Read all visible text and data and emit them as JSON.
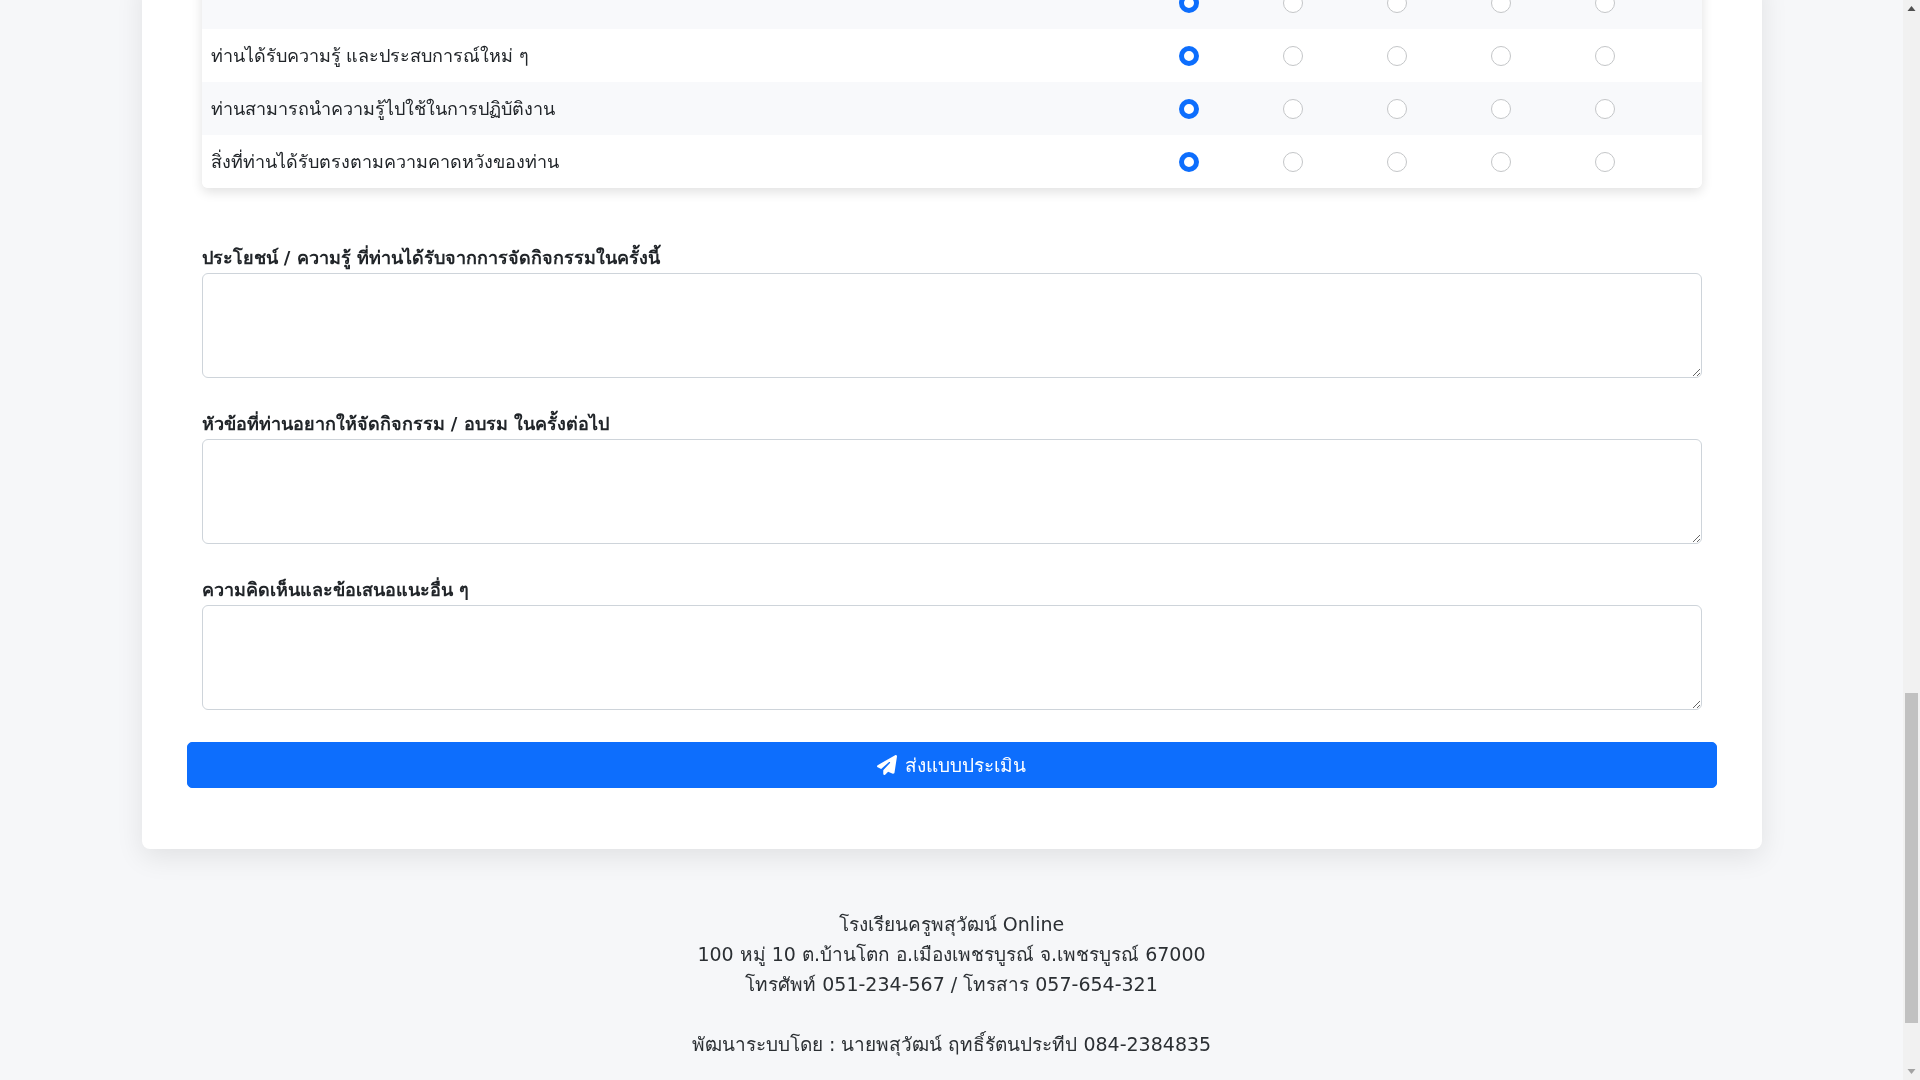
{
  "rating_table": {
    "rows": [
      {
        "ratings": [
          {
            "selected": true
          },
          {
            "selected": false
          },
          {
            "selected": false
          },
          {
            "selected": false
          },
          {
            "selected": false
          }
        ]
      },
      {
        "statement": "ท่านได้รับความรู้ และประสบการณ์ใหม่ ๆ",
        "ratings": [
          {
            "selected": true
          },
          {
            "selected": false
          },
          {
            "selected": false
          },
          {
            "selected": false
          },
          {
            "selected": false
          }
        ]
      },
      {
        "statement": "ท่านสามารถนำความรู้ไปใช้ในการปฏิบัติงาน",
        "ratings": [
          {
            "selected": true
          },
          {
            "selected": false
          },
          {
            "selected": false
          },
          {
            "selected": false
          },
          {
            "selected": false
          }
        ]
      },
      {
        "statement": "สิ่งที่ท่านได้รับตรงตามความคาดหวังของท่าน",
        "ratings": [
          {
            "selected": true
          },
          {
            "selected": false
          },
          {
            "selected": false
          },
          {
            "selected": false
          },
          {
            "selected": false
          }
        ]
      }
    ]
  },
  "questions": [
    {
      "label": "ประโยชน์ / ความรู้ ที่ท่านได้รับจากการจัดกิจกรรมในครั้งนี้"
    },
    {
      "label": "หัวข้อที่ท่านอยากให้จัดกิจกรรม / อบรม ในครั้งต่อไป"
    },
    {
      "label": "ความคิดเห็นและข้อเสนอแนะอื่น ๆ"
    }
  ],
  "submit_button": {
    "label": "ส่งแบบประเมิน"
  },
  "footer": {
    "lines": [
      "โรงเรียนครูพสุวัฒน์ Online",
      "100 หมู่ 10 ต.บ้านโตก อ.เมืองเพชรบูรณ์ จ.เพชรบูรณ์ 67000",
      "โทรศัพท์ 051-234-567 / โทรสาร 057-654-321"
    ],
    "developer_credit": "พัฒนาระบบโดย : นายพสุวัฒน์ ฤทธิ์รัตนประทีป 084-2384835"
  }
}
